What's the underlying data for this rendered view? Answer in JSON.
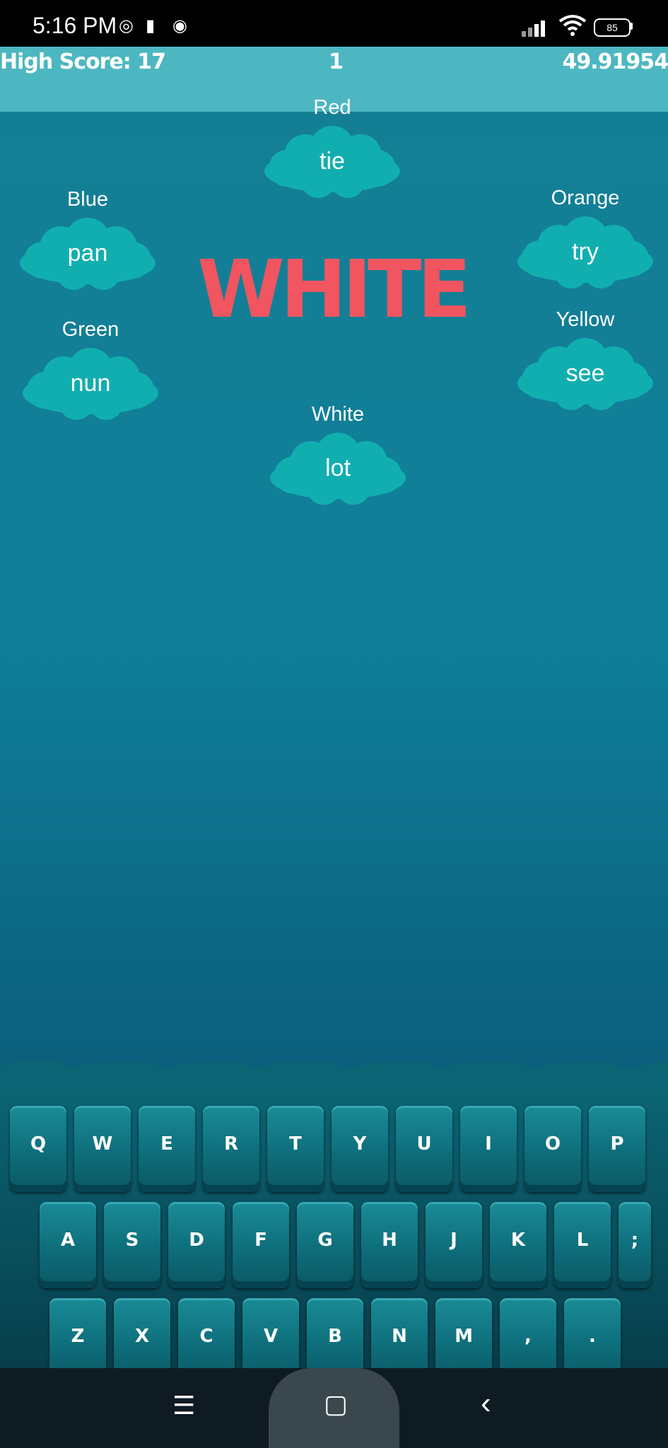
{
  "status_bar": {
    "time": "5:16 PM",
    "battery": "85",
    "icons": [
      "vpn-icon",
      "trash-icon",
      "messenger-icon",
      "signal-icon",
      "wifi-icon",
      "battery-icon"
    ]
  },
  "hud": {
    "high_score": "High Score: 17",
    "score": "1",
    "timer": "49.91954"
  },
  "target_word": "WHITE",
  "target_color": "#f05560",
  "words": [
    {
      "color_label": "Red",
      "word": "tie"
    },
    {
      "color_label": "Blue",
      "word": "pan"
    },
    {
      "color_label": "Orange",
      "word": "try"
    },
    {
      "color_label": "Green",
      "word": "nun"
    },
    {
      "color_label": "Yellow",
      "word": "see"
    },
    {
      "color_label": "White",
      "word": "lot"
    }
  ],
  "keyboard": {
    "row1": [
      "Q",
      "W",
      "E",
      "R",
      "T",
      "Y",
      "U",
      "I",
      "O",
      "P"
    ],
    "row2": [
      "A",
      "S",
      "D",
      "F",
      "G",
      "H",
      "J",
      "K",
      "L",
      ";"
    ],
    "row3": [
      "Z",
      "X",
      "C",
      "V",
      "B",
      "N",
      "M",
      ",",
      "."
    ]
  },
  "navigation": {
    "menu_icon": "☰",
    "home_icon": "▢",
    "back_icon": "‹"
  },
  "colors": {
    "hud_bar": "#4db7c1",
    "cloud": "#11aeb0",
    "key": "#0d6b78"
  }
}
